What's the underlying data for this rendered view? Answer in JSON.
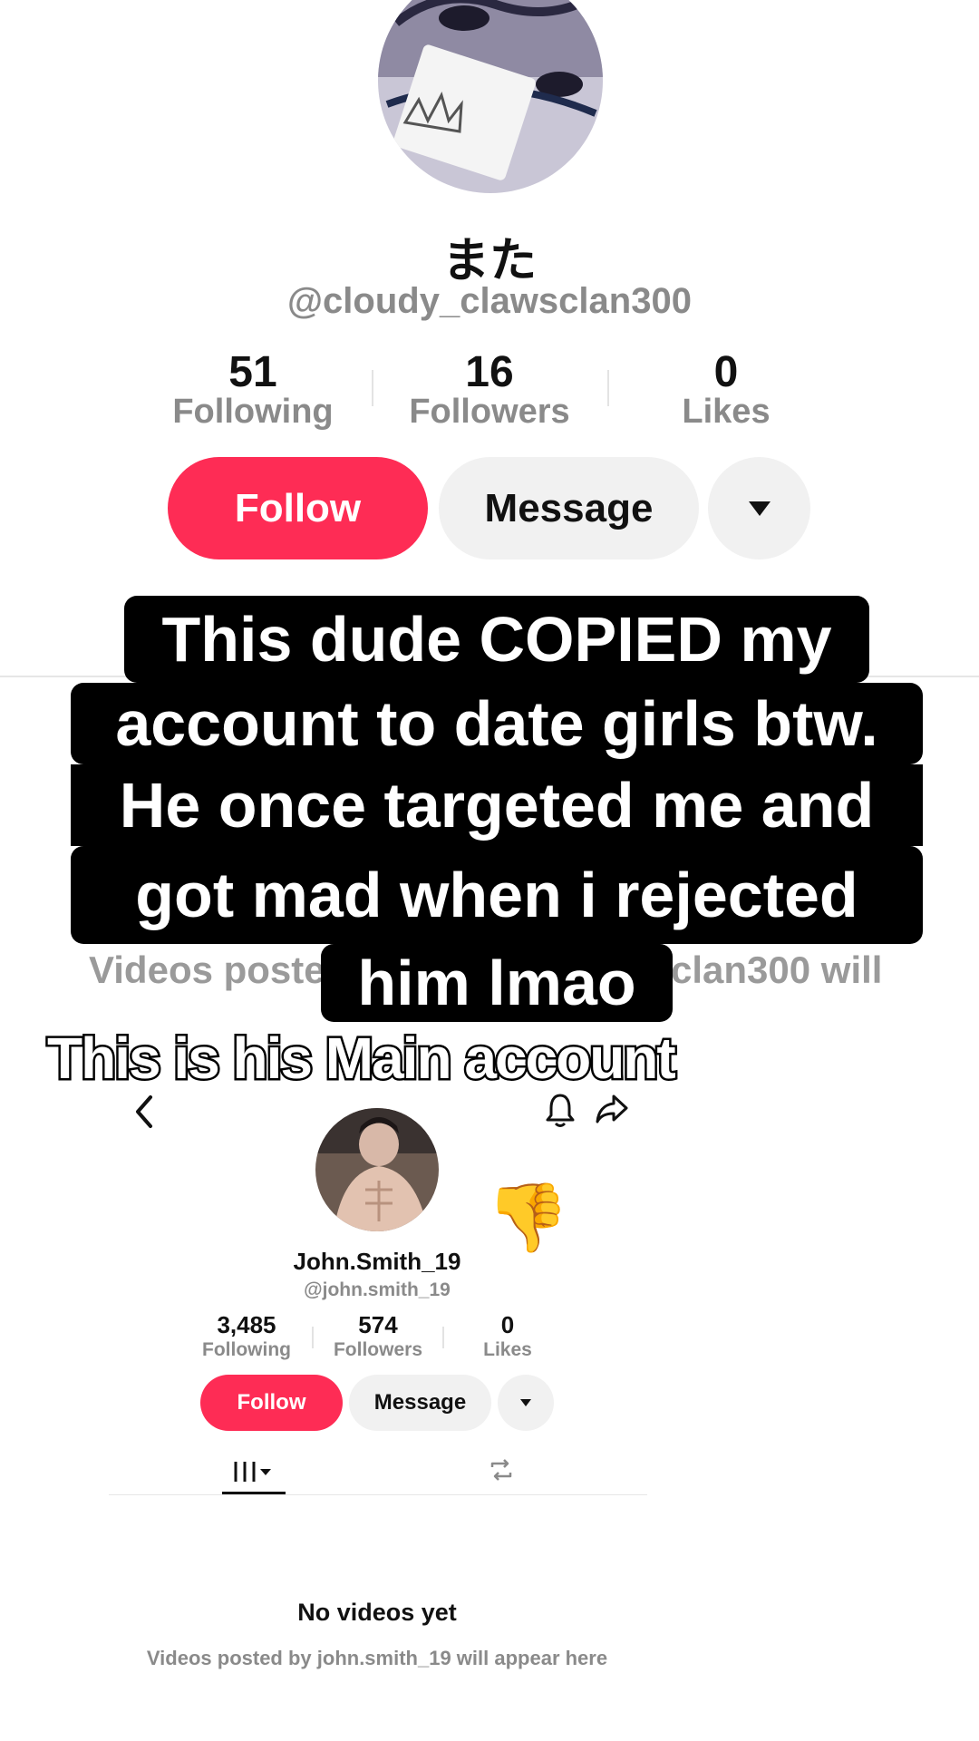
{
  "profile_top": {
    "display_name": "また",
    "handle": "@cloudy_clawsclan300",
    "stats": [
      {
        "value": "51",
        "label": "Following"
      },
      {
        "value": "16",
        "label": "Followers"
      },
      {
        "value": "0",
        "label": "Likes"
      }
    ],
    "follow_label": "Follow",
    "message_label": "Message",
    "videos_text_left": "Videos poste",
    "videos_text_right": "clan300 will"
  },
  "caption_overlay": {
    "lines": [
      "This dude COPIED my",
      "account to date girls btw.",
      "He once targeted me and",
      "got mad when i rejected",
      "him lmao"
    ],
    "secondary": "This is his Main account"
  },
  "profile_embedded": {
    "display_name": "John.Smith_19",
    "handle": "@john.smith_19",
    "stats": [
      {
        "value": "3,485",
        "label": "Following"
      },
      {
        "value": "574",
        "label": "Followers"
      },
      {
        "value": "0",
        "label": "Likes"
      }
    ],
    "follow_label": "Follow",
    "message_label": "Message",
    "empty_title": "No videos yet",
    "empty_subtitle": "Videos posted by john.smith_19 will appear here"
  },
  "emoji": "👎",
  "icons": [
    "back-icon",
    "bell-icon",
    "share-icon",
    "dropdown-icon",
    "grid-icon",
    "repost-icon"
  ],
  "colors": {
    "accent": "#fe2c55",
    "secondary_button": "#f1f1f1",
    "muted_text": "#8a8a8a"
  }
}
